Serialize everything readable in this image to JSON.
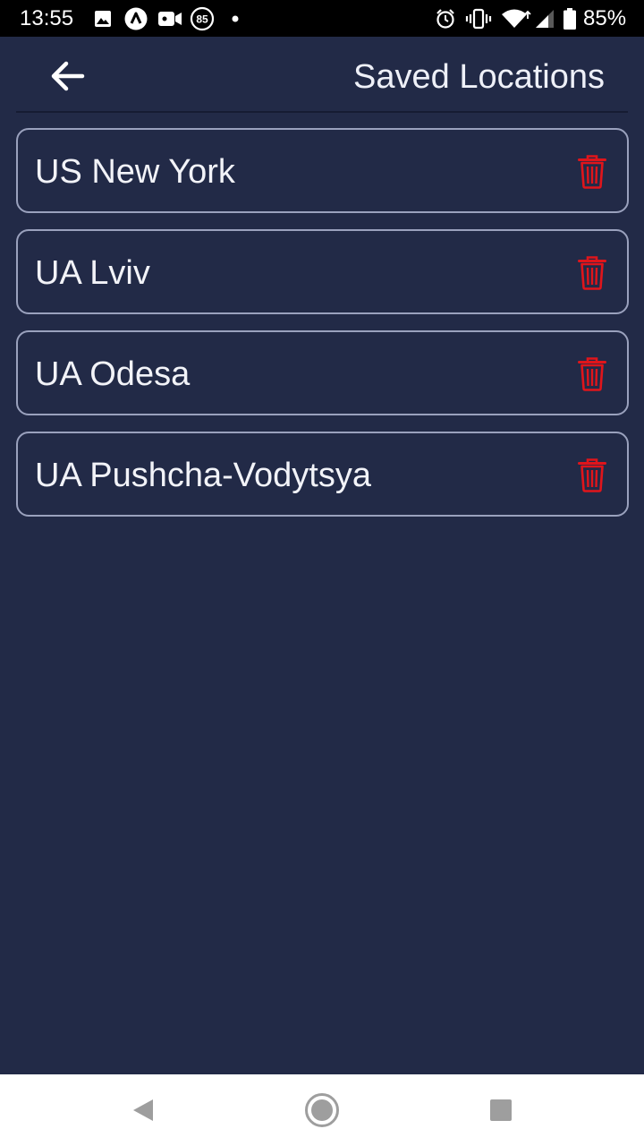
{
  "status_bar": {
    "time": "13:55",
    "battery_percent": "85%",
    "notification_badge": "85",
    "icons": [
      "image-icon",
      "app-a-icon",
      "video-camera-icon",
      "badge-85-icon",
      "dot-icon",
      "alarm-icon",
      "vibrate-icon",
      "wifi-icon",
      "signal-icon",
      "battery-icon"
    ]
  },
  "header": {
    "title": "Saved Locations",
    "back_icon": "arrow-left-icon"
  },
  "locations": [
    {
      "label": "US New York"
    },
    {
      "label": "UA Lviv"
    },
    {
      "label": "UA Odesa"
    },
    {
      "label": "UA Pushcha-Vodytsya"
    }
  ],
  "colors": {
    "background": "#222a47",
    "card_border": "#9aa1bd",
    "delete_icon": "#e0151b",
    "text": "#f2f3f8"
  },
  "nav_bar": {
    "icons": [
      "nav-back-icon",
      "nav-home-icon",
      "nav-recents-icon"
    ]
  }
}
